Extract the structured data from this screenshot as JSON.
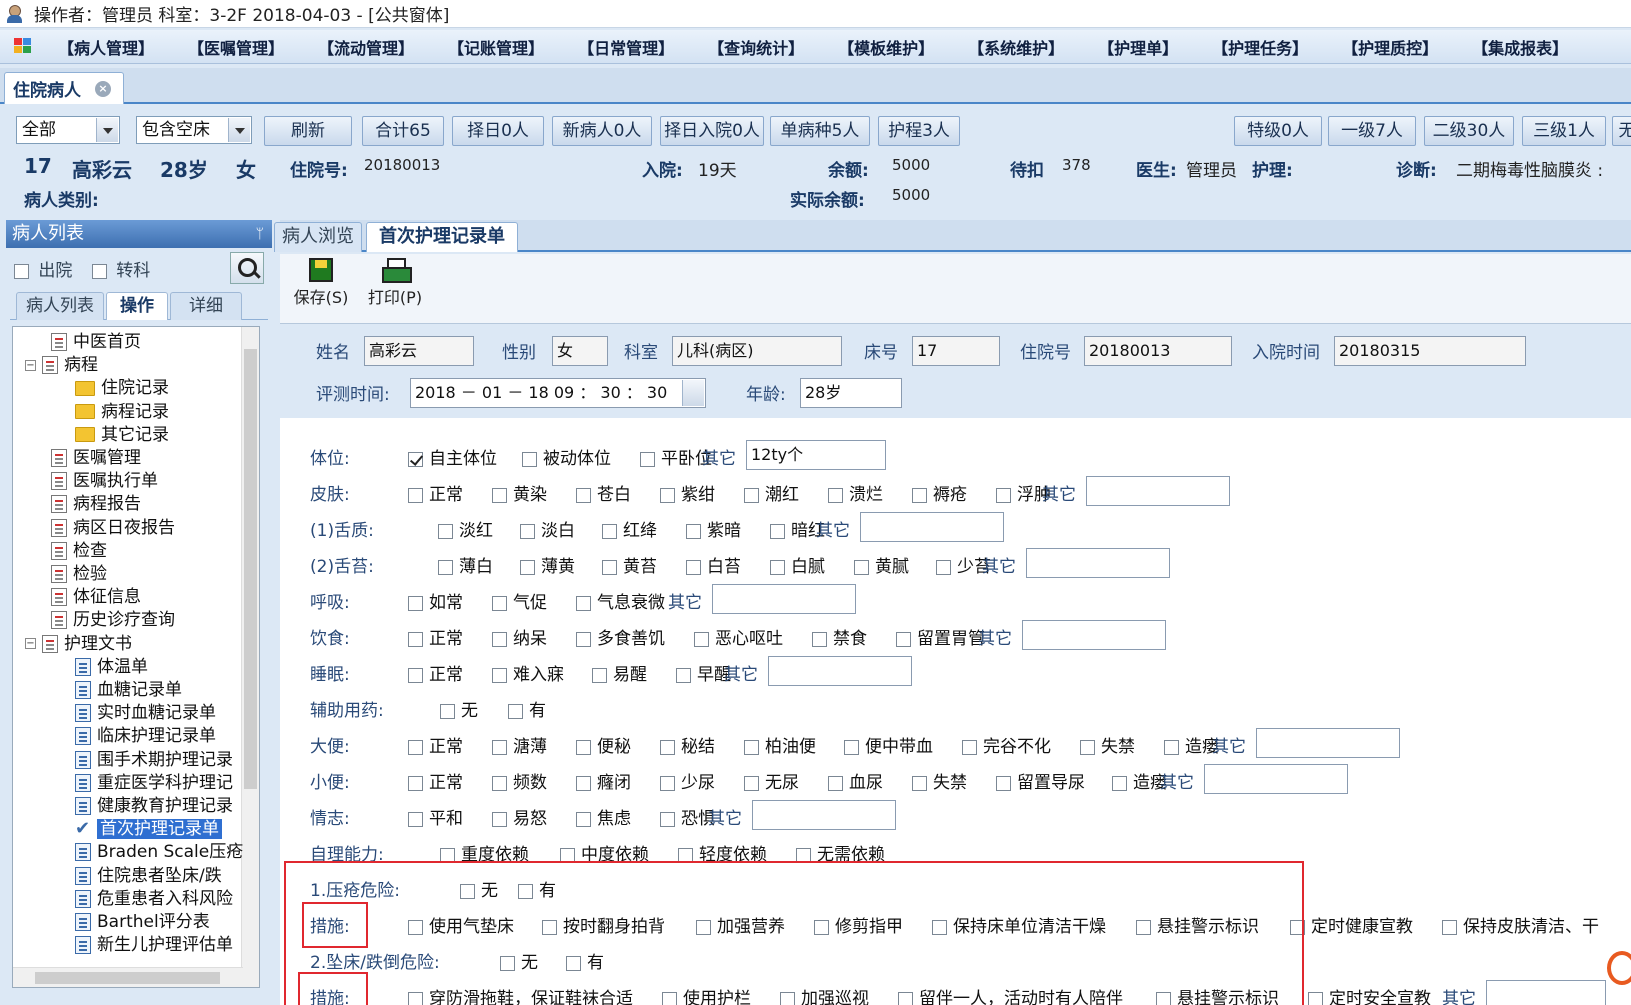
{
  "window": {
    "title": "操作者：管理员  科室：3-2F  2018-04-03 - [公共窗体]"
  },
  "menu": [
    "【病人管理】",
    "【医嘱管理】",
    "【流动管理】",
    "【记账管理】",
    "【日常管理】",
    "【查询统计】",
    "【模板维护】",
    "【系统维护】",
    "【护理单】",
    "【护理任务】",
    "【护理质控】",
    "【集成报表】"
  ],
  "doc_tab": {
    "label": "住院病人",
    "close": "×"
  },
  "toolbar": {
    "combo1": "全部",
    "combo2": "包含空床",
    "buttons_left": [
      "刷新",
      "合计65",
      "择日0人",
      "新病人0人",
      "择日入院0人",
      "单病种5人",
      "护程3人"
    ],
    "buttons_right": [
      "特级0人",
      "一级7人",
      "二级30人",
      "三级1人",
      "无"
    ]
  },
  "patient": {
    "bed": "17",
    "name": "高彩云",
    "age": "28岁",
    "sex": "女",
    "inpatient_no_label": "住院号:",
    "inpatient_no": "20180013",
    "admit_label": "入院:",
    "admit_days": "19天",
    "balance_label": "余额:",
    "balance": "5000",
    "pending_label": "待扣",
    "pending": "378",
    "doctor_label": "医生:",
    "doctor": "管理员",
    "nurse_label": "护理:",
    "diag_label": "诊断:",
    "diagnosis": "二期梅毒性脑膜炎 :",
    "category_label": "病人类别:",
    "actual_balance_label": "实际余额:",
    "actual_balance": "5000"
  },
  "left_panel": {
    "title": "病人列表",
    "pin": "ᛘ",
    "discharge": "出院",
    "transfer": "转科",
    "tabs": [
      "病人列表",
      "操作",
      "详细"
    ],
    "active_tab": 1,
    "tree": [
      {
        "label": "中医首页",
        "icon": "doc",
        "level": 1
      },
      {
        "label": "病程",
        "icon": "doc",
        "level": 0,
        "expand": "minus"
      },
      {
        "label": "住院记录",
        "icon": "folder",
        "level": 2
      },
      {
        "label": "病程记录",
        "icon": "folder",
        "level": 2
      },
      {
        "label": "其它记录",
        "icon": "folder",
        "level": 2
      },
      {
        "label": "医嘱管理",
        "icon": "doc",
        "level": 1
      },
      {
        "label": "医嘱执行单",
        "icon": "doc",
        "level": 1
      },
      {
        "label": "病程报告",
        "icon": "doc",
        "level": 1
      },
      {
        "label": "病区日夜报告",
        "icon": "doc",
        "level": 1
      },
      {
        "label": "检查",
        "icon": "doc",
        "level": 1
      },
      {
        "label": "检验",
        "icon": "doc",
        "level": 1
      },
      {
        "label": "体征信息",
        "icon": "doc",
        "level": 1
      },
      {
        "label": "历史诊疗查询",
        "icon": "doc",
        "level": 1
      },
      {
        "label": "护理文书",
        "icon": "doc",
        "level": 0,
        "expand": "minus"
      },
      {
        "label": "体温单",
        "icon": "blue",
        "level": 2
      },
      {
        "label": "血糖记录单",
        "icon": "blue",
        "level": 2
      },
      {
        "label": "实时血糖记录单",
        "icon": "blue",
        "level": 2
      },
      {
        "label": "临床护理记录单",
        "icon": "blue",
        "level": 2
      },
      {
        "label": "围手术期护理记录",
        "icon": "blue",
        "level": 2
      },
      {
        "label": "重症医学科护理记",
        "icon": "blue",
        "level": 2
      },
      {
        "label": "健康教育护理记录",
        "icon": "blue",
        "level": 2
      },
      {
        "label": "首次护理记录单",
        "icon": "check",
        "level": 2,
        "selected": true
      },
      {
        "label": "Braden Scale压疮",
        "icon": "blue",
        "level": 2
      },
      {
        "label": "住院患者坠床/跌",
        "icon": "blue",
        "level": 2
      },
      {
        "label": "危重患者入科风险",
        "icon": "blue",
        "level": 2
      },
      {
        "label": "Barthel评分表",
        "icon": "blue",
        "level": 2
      },
      {
        "label": "新生儿护理评估单",
        "icon": "blue",
        "level": 2
      }
    ]
  },
  "main": {
    "tabs": [
      "病人浏览",
      "首次护理记录单"
    ],
    "active_tab": 1,
    "save_label": "保存(S)",
    "print_label": "打印(P)",
    "header_fields": {
      "name_label": "姓名",
      "name": "高彩云",
      "sex_label": "性别",
      "sex": "女",
      "dept_label": "科室",
      "dept": "儿科(病区)",
      "bed_label": "床号",
      "bed": "17",
      "inpatient_label": "住院号",
      "inpatient": "20180013",
      "admit_label": "入院时间",
      "admit": "20180315",
      "eval_label": "评测时间:",
      "eval_time": "2018 － 01 － 18    09 ： 30 ： 30",
      "age_label": "年龄:",
      "age": "28岁"
    },
    "rows": [
      {
        "label": "体位:",
        "items": [
          "自主体位",
          "被动体位",
          "平卧位"
        ],
        "checked": [
          0
        ],
        "other": "其它",
        "other_value": "12ty个"
      },
      {
        "label": "皮肤:",
        "items": [
          "正常",
          "黄染",
          "苍白",
          "紫绀",
          "潮红",
          "溃烂",
          "褥疮",
          "浮肿"
        ],
        "other": "其它",
        "other_value": ""
      },
      {
        "label": "(1)舌质:",
        "items": [
          "淡红",
          "淡白",
          "红绛",
          "紫暗",
          "暗红"
        ],
        "other": "其它",
        "other_value": ""
      },
      {
        "label": "(2)舌苔:",
        "items": [
          "薄白",
          "薄黄",
          "黄苔",
          "白苔",
          "白腻",
          "黄腻",
          "少苔"
        ],
        "other": "其它",
        "other_value": ""
      },
      {
        "label": "呼吸:",
        "items": [
          "如常",
          "气促",
          "气息衰微"
        ],
        "other": "其它",
        "other_value": ""
      },
      {
        "label": "饮食:",
        "items": [
          "正常",
          "纳呆",
          "多食善饥",
          "恶心呕吐",
          "禁食",
          "留置胃管"
        ],
        "other": "其它",
        "other_value": ""
      },
      {
        "label": "睡眠:",
        "items": [
          "正常",
          "难入寐",
          "易醒",
          "早醒"
        ],
        "other": "其它",
        "other_value": ""
      },
      {
        "label": "辅助用药:",
        "items": [
          "无",
          "有"
        ]
      },
      {
        "label": "大便:",
        "items": [
          "正常",
          "溏薄",
          "便秘",
          "秘结",
          "柏油便",
          "便中带血",
          "完谷不化",
          "失禁",
          "造瘘"
        ],
        "other": "其它",
        "other_value": ""
      },
      {
        "label": "小便:",
        "items": [
          "正常",
          "频数",
          "癃闭",
          "少尿",
          "无尿",
          "血尿",
          "失禁",
          "留置导尿",
          "造瘘"
        ],
        "other": "其它",
        "other_value": ""
      },
      {
        "label": "情志:",
        "items": [
          "平和",
          "易怒",
          "焦虑",
          "恐惧"
        ],
        "other": "其它",
        "other_value": ""
      },
      {
        "label": "自理能力:",
        "items": [
          "重度依赖",
          "中度依赖",
          "轻度依赖",
          "无需依赖"
        ]
      },
      {
        "label": "1.压疮危险:",
        "items": [
          "无",
          "有"
        ]
      },
      {
        "label": "措施:",
        "items": [
          "使用气垫床",
          "按时翻身拍背",
          "加强营养",
          "修剪指甲",
          "保持床单位清洁干燥",
          "悬挂警示标识",
          "定时健康宣教",
          "保持皮肤清洁、干"
        ]
      },
      {
        "label": "2.坠床/跌倒危险:",
        "items": [
          "无",
          "有"
        ]
      },
      {
        "label": "措施:",
        "items": [
          "穿防滑拖鞋，保证鞋袜合适",
          "使用护栏",
          "加强巡视",
          "留伴一人，活动时有人陪伴",
          "悬挂警示标识",
          "定时安全宣教"
        ],
        "other": "其它",
        "other_value": ""
      }
    ]
  }
}
